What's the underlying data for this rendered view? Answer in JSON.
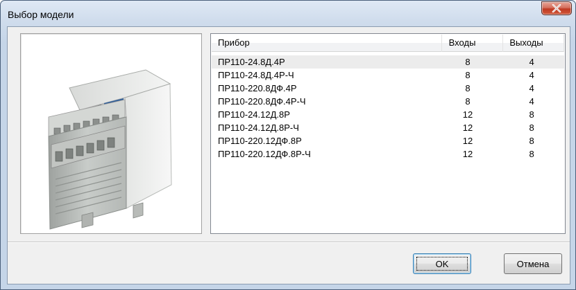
{
  "window": {
    "title": "Выбор модели"
  },
  "list": {
    "columns": {
      "device": "Прибор",
      "inputs": "Входы",
      "outputs": "Выходы"
    },
    "rows": [
      {
        "device": "ПР110-24.8Д.4Р",
        "inputs": "8",
        "outputs": "4"
      },
      {
        "device": "ПР110-24.8Д.4Р-Ч",
        "inputs": "8",
        "outputs": "4"
      },
      {
        "device": "ПР110-220.8ДФ.4Р",
        "inputs": "8",
        "outputs": "4"
      },
      {
        "device": "ПР110-220.8ДФ.4Р-Ч",
        "inputs": "8",
        "outputs": "4"
      },
      {
        "device": "ПР110-24.12Д.8Р",
        "inputs": "12",
        "outputs": "8"
      },
      {
        "device": "ПР110-24.12Д.8Р-Ч",
        "inputs": "12",
        "outputs": "8"
      },
      {
        "device": "ПР110-220.12ДФ.8Р",
        "inputs": "12",
        "outputs": "8"
      },
      {
        "device": "ПР110-220.12ДФ.8Р-Ч",
        "inputs": "12",
        "outputs": "8"
      }
    ],
    "selected_index": 0
  },
  "buttons": {
    "ok": "OK",
    "cancel": "Отмена"
  },
  "colors": {
    "device_body": "#e6e8e6",
    "device_panel": "#2f5f9a",
    "close_button": "#c8452b"
  }
}
